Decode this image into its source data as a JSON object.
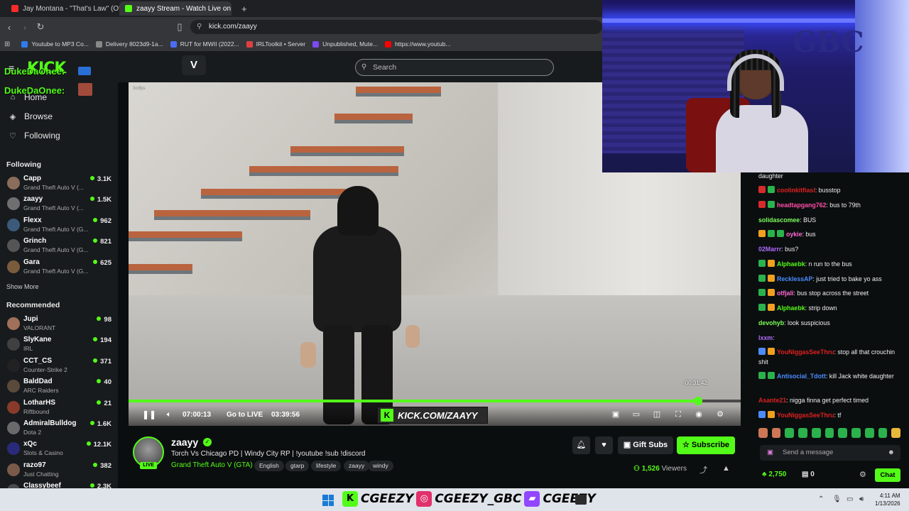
{
  "browser": {
    "tabs": [
      {
        "label": "Jay Montana - \"That's Law\" (Offic"
      },
      {
        "label": "zaayy Stream - Watch Live on"
      }
    ],
    "new_tab": "+",
    "url": "kick.com/zaayy",
    "bookmarks": [
      {
        "label": "Youtube to MP3 Co...",
        "color": "#2f7bf0"
      },
      {
        "label": "Delivery 8023d9-1a...",
        "color": "#888888"
      },
      {
        "label": "RUT for MWII (2022...",
        "color": "#4a6cf7"
      },
      {
        "label": "IRLToolkit • Server",
        "color": "#e04040"
      },
      {
        "label": "Unpublished, Mute...",
        "color": "#7b4af0"
      },
      {
        "label": "https://www.youtub...",
        "color": "#ff0000"
      }
    ]
  },
  "overlay": {
    "dukedaonee_1": "DukeDaOnee:",
    "dukedaonee_2": "DukeDaOnee:"
  },
  "site": {
    "search_placeholder": "Search",
    "nav": [
      {
        "label": "Home",
        "icon": "home-icon"
      },
      {
        "label": "Browse",
        "icon": "compass-icon"
      },
      {
        "label": "Following",
        "icon": "heart-icon"
      }
    ],
    "following_heading": "Following",
    "following": [
      {
        "name": "Capp",
        "game": "Grand Theft Auto V (...",
        "viewers": "3.1K",
        "color": "#8a6d5a"
      },
      {
        "name": "zaayy",
        "game": "Grand Theft Auto V (...",
        "viewers": "1.5K",
        "color": "#6f6f6f"
      },
      {
        "name": "Flexx",
        "game": "Grand Theft Auto V (G...",
        "viewers": "962",
        "color": "#3c5a7a"
      },
      {
        "name": "Grinch",
        "game": "Grand Theft Auto V (G...",
        "viewers": "821",
        "color": "#555555"
      },
      {
        "name": "Gara",
        "game": "Grand Theft Auto V (G...",
        "viewers": "625",
        "color": "#7a5b3c"
      }
    ],
    "show_more": "Show More",
    "recommended_heading": "Recommended",
    "recommended": [
      {
        "name": "Jupi",
        "game": "VALORANT",
        "viewers": "98",
        "color": "#a0705a"
      },
      {
        "name": "SlyKane",
        "game": "IRL",
        "viewers": "194",
        "color": "#404040"
      },
      {
        "name": "CCT_CS",
        "game": "Counter-Strike 2",
        "viewers": "371",
        "color": "#222222"
      },
      {
        "name": "BaldDad",
        "game": "ARC Raiders",
        "viewers": "40",
        "color": "#5a4a3a"
      },
      {
        "name": "LotharHS",
        "game": "Riftbound",
        "viewers": "21",
        "color": "#8a3a2a"
      },
      {
        "name": "AdmiralBulldog",
        "game": "Dota 2",
        "viewers": "1.6K",
        "color": "#6a6a6a"
      },
      {
        "name": "xQc",
        "game": "Slots & Casino",
        "viewers": "12.1K",
        "color": "#2a2a7a"
      },
      {
        "name": "razo97",
        "game": "Just Chatting",
        "viewers": "382",
        "color": "#7a5a4a"
      },
      {
        "name": "Classybeef",
        "game": "",
        "viewers": "2.3K",
        "color": "#4a4a4a"
      }
    ]
  },
  "player": {
    "watermark": "3cdfps",
    "current_time": "07:00:13",
    "go_live": "Go to LIVE",
    "duration": "03:39:56",
    "hover_time": "-00:31:42",
    "progress": 0.93,
    "banner": "KICK.COM/ZAAYY",
    "banner_k": "K"
  },
  "stream": {
    "name": "zaayy",
    "live": "LIVE",
    "title": "Torch Vs Chicago PD | Windy City RP | !youtube !sub !discord",
    "category": "Grand Theft Auto V (GTA)",
    "tags": [
      "English",
      "gtarp",
      "lifestyle",
      "zaayy",
      "windy"
    ],
    "gift_subs": "Gift Subs",
    "subscribe": "Subscribe",
    "viewers": "1,526",
    "viewers_label": "Viewers"
  },
  "webcam": {
    "sign": "GBC"
  },
  "chat": {
    "messages": [
      {
        "user": "",
        "text": "daughter",
        "color": "#ffffff",
        "badges": []
      },
      {
        "user": "coolinkitfiasl",
        "text": ": busstop",
        "color": "#e02020",
        "badges": [
          "#d62b2b",
          "#2bb24c"
        ]
      },
      {
        "user": "headtapgang762",
        "text": ": bus to 79th",
        "color": "#ff4da6",
        "badges": [
          "#d62b2b",
          "#2bb24c"
        ]
      },
      {
        "user": "solidascomee",
        "text": ": BUS",
        "color": "#7cff5b",
        "badges": []
      },
      {
        "user": "oykie",
        "text": ": bus",
        "color": "#ff6ad5",
        "badges": [
          "#f0a020",
          "#2bb24c",
          "#2bb24c"
        ]
      },
      {
        "user": "02Marrr",
        "text": ": bus?",
        "color": "#b06cff",
        "badges": []
      },
      {
        "user": "Alphaebk",
        "text": ": n run to the bus",
        "color": "#53fc18",
        "badges": [
          "#2bb24c",
          "#f0a020"
        ]
      },
      {
        "user": "RecklessAP",
        "text": ": just tried to bake yo ass",
        "color": "#4a8cff",
        "badges": [
          "#2bb24c",
          "#f0a020"
        ]
      },
      {
        "user": "otfjali",
        "text": ": bus stop across the street",
        "color": "#ff6ad5",
        "badges": [
          "#2bb24c",
          "#f0a020"
        ]
      },
      {
        "user": "Alphaebk",
        "text": ": strip down",
        "color": "#53fc18",
        "badges": [
          "#2bb24c",
          "#f0a020"
        ]
      },
      {
        "user": "devohyb",
        "text": ": look suspicious",
        "color": "#7cff5b",
        "badges": []
      },
      {
        "user": "lxxm",
        "text": ":",
        "color": "#b06cff",
        "badges": []
      },
      {
        "user": "YouNiggasSeeThru",
        "text": ": stop all that crouchin shit",
        "color": "#e02020",
        "badges": [
          "#4a8cff",
          "#f0a020"
        ]
      },
      {
        "user": "Antisocial_Tdott",
        "text": ": kill Jack white daughter",
        "color": "#4a8cff",
        "badges": [
          "#2bb24c",
          "#2bb24c"
        ]
      },
      {
        "user": "Asante21",
        "text": ": nigga finna get perfect timed",
        "color": "#e02020",
        "badges": []
      },
      {
        "user": "YouNiggasSeeThru",
        "text": ": tf",
        "color": "#e02020",
        "badges": [
          "#4a8cff",
          "#f0a020"
        ]
      }
    ],
    "input_placeholder": "Send a message",
    "points": "2,750",
    "gifts": "0",
    "chat_button": "Chat"
  },
  "taskbar": {
    "handle_1": "CGEEZY",
    "handle_2": "CGEEZY_GBC",
    "handle_3": "CGEEZY",
    "time": "4:11 AM",
    "date": "1/13/2026"
  }
}
